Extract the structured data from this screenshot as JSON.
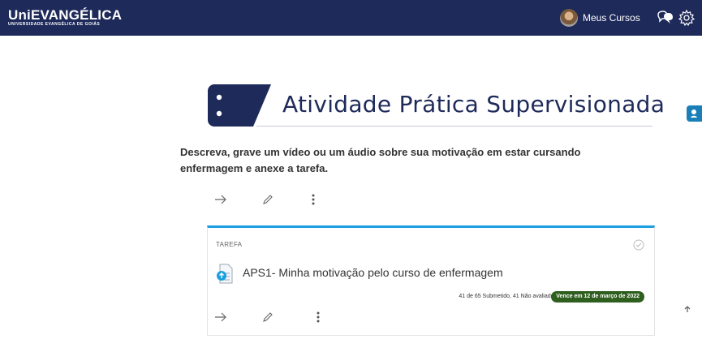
{
  "navbar": {
    "logo_main": "UniEVANGÉLICA",
    "logo_sub": "UNIVERSIDADE EVANGÉLICA DE GOIÁS",
    "meus_cursos": "Meus Cursos",
    "icons": [
      "avatar",
      "chat-icon",
      "gear-icon"
    ],
    "bg_color": "#1e2a5a"
  },
  "banner": {
    "title": "Atividade Prática Supervisionada"
  },
  "section": {
    "description": "Descreva, grave um vídeo ou um áudio sobre sua motivação em estar cursando enfermagem e anexe a tarefa.",
    "actions": [
      "arrow-right-icon",
      "pencil-icon",
      "more-vertical-icon"
    ]
  },
  "activity": {
    "type_label": "TAREFA",
    "title": "APS1- Minha motivação pelo curso de enfermagem",
    "status": "41 de 65 Submetido, 41 Não avaliados",
    "due": "Vence em 12 de março de 2022",
    "due_color": "#2f5f1f",
    "accent_color": "#1a9fe0",
    "actions": [
      "arrow-right-icon",
      "pencil-icon",
      "more-vertical-icon"
    ]
  }
}
